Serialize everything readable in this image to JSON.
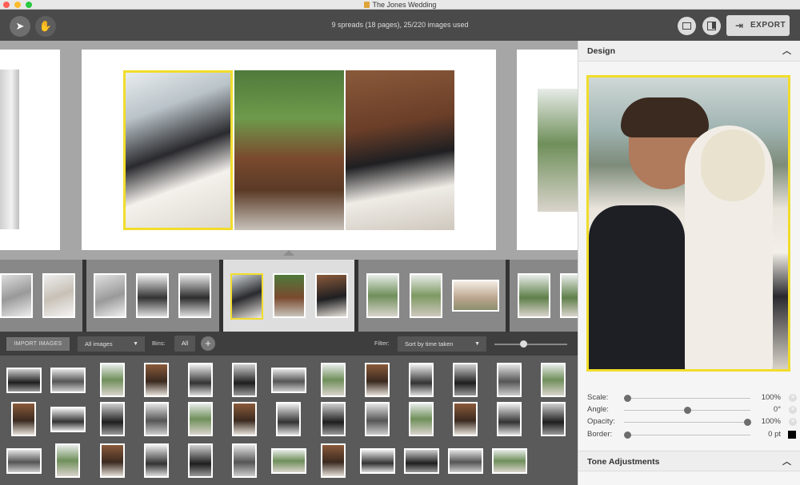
{
  "window": {
    "title": "The Jones Wedding"
  },
  "toolbar": {
    "status": "9 spreads (18 pages), 25/220 images used",
    "export_label": "EXPORT"
  },
  "import_bar": {
    "import_label": "IMPORT IMAGES",
    "images_dropdown": "All images",
    "bins_label": "Bins:",
    "bin_all": "All",
    "filter_label": "Filter:",
    "sort_dropdown": "Sort by time taken",
    "zoom_level": 0.4
  },
  "panel": {
    "design_title": "Design",
    "tone_title": "Tone Adjustments",
    "controls": [
      {
        "label": "Scale:",
        "value": "100%",
        "level": 0.0
      },
      {
        "label": "Angle:",
        "value": "0°",
        "level": 0.5
      },
      {
        "label": "Opacity:",
        "value": "100%",
        "level": 1.0
      },
      {
        "label": "Border:",
        "value": "0 pt",
        "level": 0.0
      }
    ],
    "border_color": "#000000"
  },
  "colors": {
    "selection": "#f1dd2b",
    "toolbar": "#4a4a4a",
    "canvas": "#a6a6a6"
  }
}
